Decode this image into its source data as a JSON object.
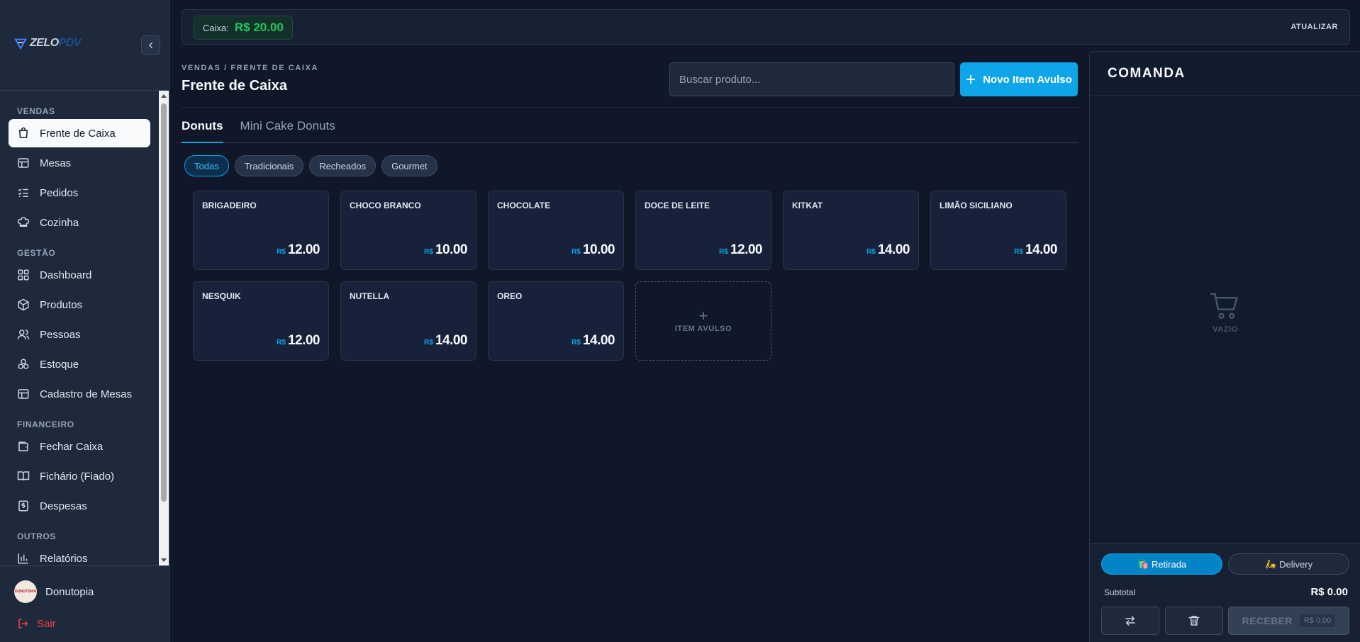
{
  "sidebar": {
    "logo": {
      "left": "ZELO",
      "right": "PDV"
    },
    "sections": [
      {
        "title": "VENDAS",
        "items": [
          {
            "label": "Frente de Caixa",
            "icon": "shopping-bag-icon",
            "active": true
          },
          {
            "label": "Mesas",
            "icon": "table-icon"
          },
          {
            "label": "Pedidos",
            "icon": "list-checks-icon"
          },
          {
            "label": "Cozinha",
            "icon": "chef-hat-icon"
          }
        ]
      },
      {
        "title": "GESTÃO",
        "items": [
          {
            "label": "Dashboard",
            "icon": "dashboard-icon"
          },
          {
            "label": "Produtos",
            "icon": "package-icon"
          },
          {
            "label": "Pessoas",
            "icon": "users-icon"
          },
          {
            "label": "Estoque",
            "icon": "boxes-icon"
          },
          {
            "label": "Cadastro de Mesas",
            "icon": "table-icon"
          }
        ]
      },
      {
        "title": "FINANCEIRO",
        "items": [
          {
            "label": "Fechar Caixa",
            "icon": "wallet-icon"
          },
          {
            "label": "Fichário (Fiado)",
            "icon": "book-icon"
          },
          {
            "label": "Despesas",
            "icon": "receipt-icon"
          }
        ]
      },
      {
        "title": "OUTROS",
        "items": [
          {
            "label": "Relatórios",
            "icon": "bar-chart-icon"
          }
        ]
      }
    ],
    "user": {
      "name": "Donutopia",
      "avatar_text": "DONUTOPIA"
    },
    "logout": "Sair"
  },
  "topbar": {
    "cash_label": "Caixa:",
    "cash_value": "R$ 20.00",
    "refresh": "ATUALIZAR"
  },
  "main": {
    "breadcrumb": "VENDAS / FRENTE DE CAIXA",
    "title": "Frente de Caixa",
    "search_placeholder": "Buscar produto...",
    "new_item_label": "Novo Item Avulso",
    "tabs": [
      "Donuts",
      "Mini Cake Donuts"
    ],
    "filters": [
      "Todas",
      "Tradicionais",
      "Recheados",
      "Gourmet"
    ],
    "currency": "R$",
    "products": [
      {
        "name": "BRIGADEIRO",
        "price": "12.00"
      },
      {
        "name": "CHOCO BRANCO",
        "price": "10.00"
      },
      {
        "name": "CHOCOLATE",
        "price": "10.00"
      },
      {
        "name": "DOCE DE LEITE",
        "price": "12.00"
      },
      {
        "name": "KITKAT",
        "price": "14.00"
      },
      {
        "name": "LIMÃO SICILIANO",
        "price": "14.00"
      },
      {
        "name": "NESQUIK",
        "price": "12.00"
      },
      {
        "name": "NUTELLA",
        "price": "14.00"
      },
      {
        "name": "OREO",
        "price": "14.00"
      }
    ],
    "avulso_label": "ITEM AVULSO"
  },
  "comanda": {
    "title": "COMANDA",
    "empty_label": "VAZIO",
    "modes": {
      "retirada": "Retirada",
      "delivery": "Delivery",
      "retirada_emoji": "🛍️",
      "delivery_emoji": "🛵"
    },
    "subtotal_label": "Subtotal",
    "subtotal_value": "R$ 0.00",
    "receive_label": "RECEBER",
    "receive_amount": "R$ 0.00"
  },
  "colors": {
    "accent": "#0ea5e9",
    "success": "#22c55e",
    "danger": "#ef4444",
    "background": "#0f1729"
  }
}
